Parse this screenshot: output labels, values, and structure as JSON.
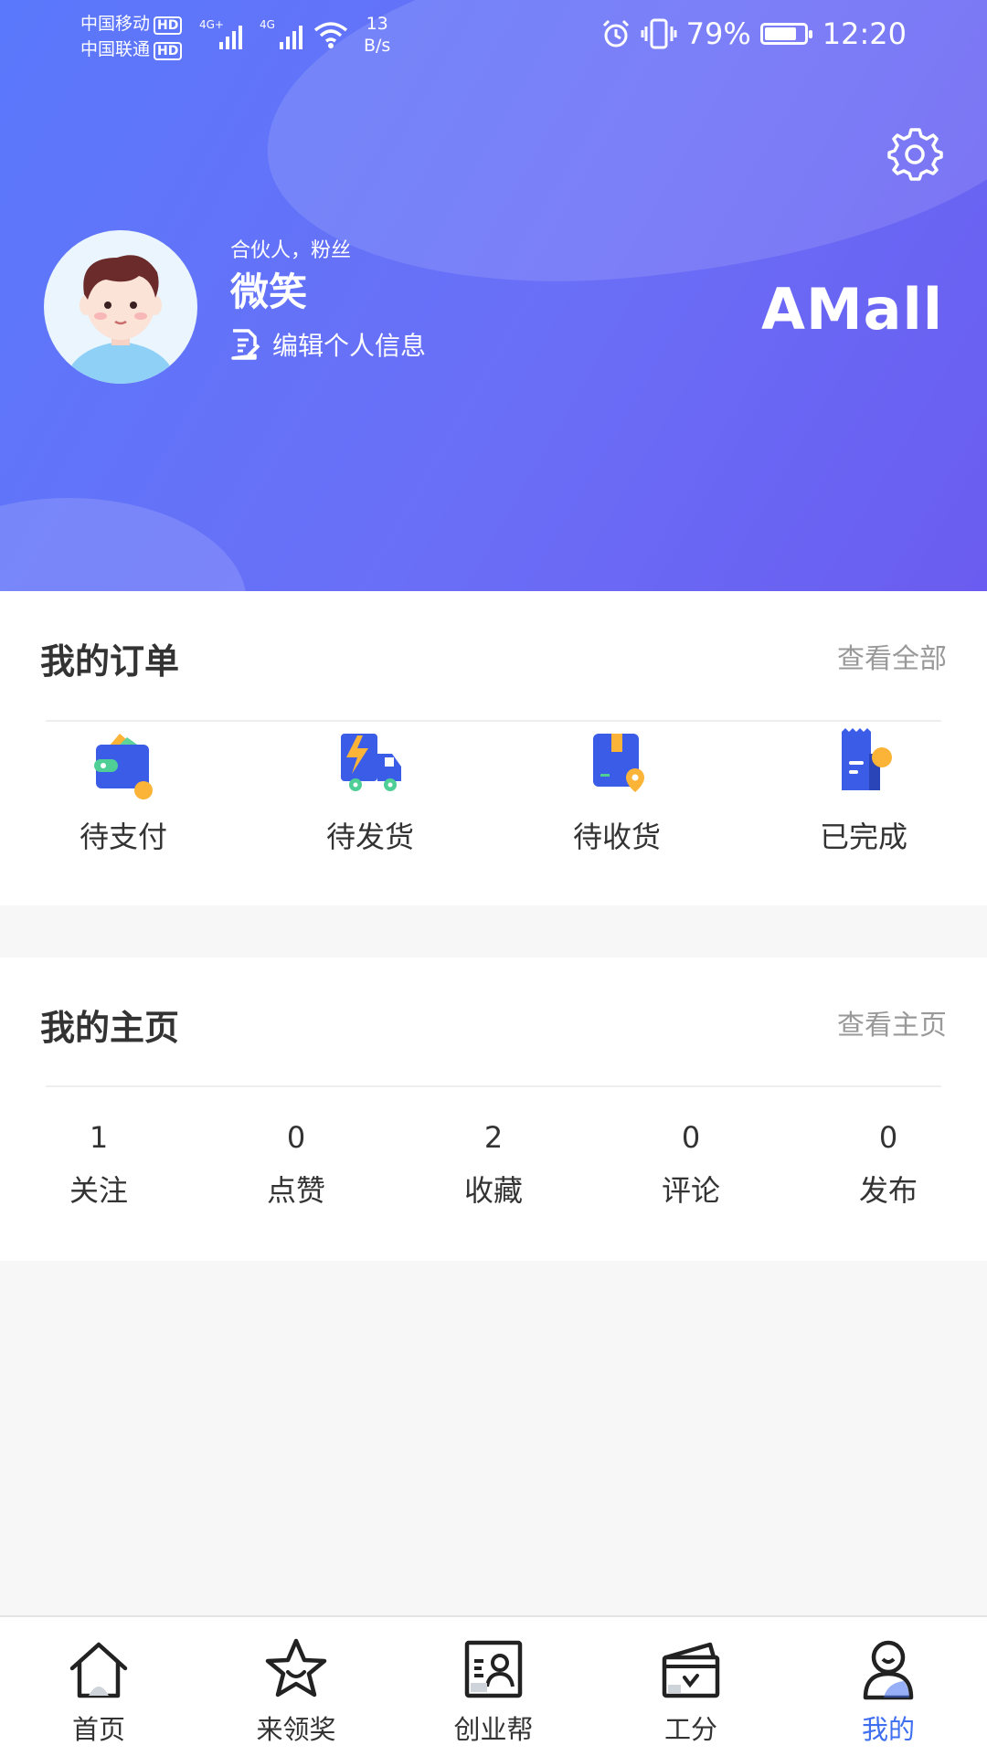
{
  "status_bar": {
    "carrier1": "中国移动",
    "carrier2": "中国联通",
    "hd": "HD",
    "net1": "4G+",
    "net2": "4G",
    "speed_value": "13",
    "speed_unit": "B/s",
    "battery": "79%",
    "time": "12:20"
  },
  "profile": {
    "role": "合伙人，粉丝",
    "name": "微笑",
    "edit_label": "编辑个人信息",
    "brand": "AMall"
  },
  "orders": {
    "title": "我的订单",
    "view_all": "查看全部",
    "items": [
      {
        "label": "待支付",
        "icon": "wallet-icon"
      },
      {
        "label": "待发货",
        "icon": "delivery-truck-icon"
      },
      {
        "label": "待收货",
        "icon": "package-location-icon"
      },
      {
        "label": "已完成",
        "icon": "receipt-icon"
      }
    ]
  },
  "homepage": {
    "title": "我的主页",
    "view_home": "查看主页",
    "stats": [
      {
        "value": "1",
        "label": "关注"
      },
      {
        "value": "0",
        "label": "点赞"
      },
      {
        "value": "2",
        "label": "收藏"
      },
      {
        "value": "0",
        "label": "评论"
      },
      {
        "value": "0",
        "label": "发布"
      }
    ]
  },
  "tabbar": {
    "items": [
      {
        "label": "首页",
        "icon": "home-icon"
      },
      {
        "label": "来领奖",
        "icon": "star-icon"
      },
      {
        "label": "创业帮",
        "icon": "id-card-icon"
      },
      {
        "label": "工分",
        "icon": "wallet-card-icon"
      },
      {
        "label": "我的",
        "icon": "user-icon"
      }
    ],
    "active_index": 4
  },
  "colors": {
    "header_gradient_start": "#5a78fb",
    "header_gradient_end": "#6a5cf0",
    "accent_blue": "#3f6ef0",
    "icon_orange": "#fbb437"
  }
}
